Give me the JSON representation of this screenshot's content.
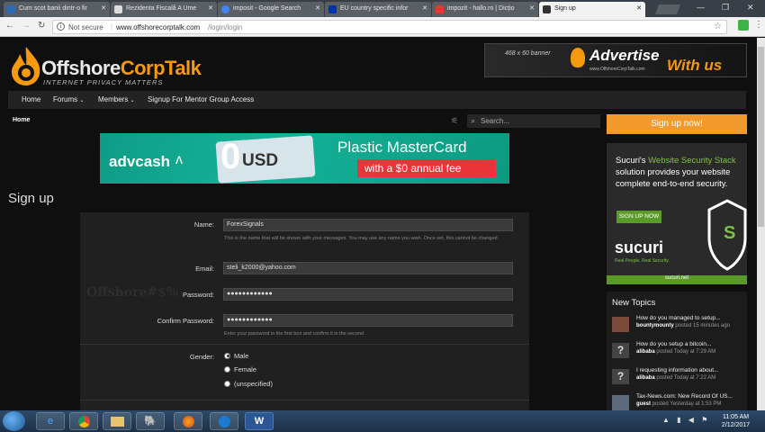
{
  "browser": {
    "tabs": [
      {
        "title": "Cum scot banii dintr-o fir",
        "favicon": "#2c6bb6"
      },
      {
        "title": "Rezidenta Fiscală A Ume",
        "favicon": "#ddd"
      },
      {
        "title": "imposit - Google Search",
        "favicon": "#4285f4"
      },
      {
        "title": "EU country specific infor",
        "favicon": "#0033aa"
      },
      {
        "title": "impozit - hallo.ro | Dicțio",
        "favicon": "#e33"
      },
      {
        "title": "Sign up",
        "favicon": "#333"
      }
    ],
    "security": "Not secure",
    "url_host": "www.offshorecorptalk.com",
    "url_path": "/login/login"
  },
  "site": {
    "logo_main": "Offshore",
    "logo_accent": "CorpTalk",
    "tagline": "INTERNET PRIVACY MATTERS",
    "ad_top": {
      "size": "468 x 60 banner",
      "line1": "Advertise",
      "line2": "With us",
      "url": "www.OffshoreCorpTalk.com"
    },
    "nav": [
      "Home",
      "Forums",
      "Members",
      "Signup For Mentor Group Access"
    ],
    "breadcrumb": "Home",
    "search_placeholder": "Search...",
    "banner": {
      "brand": "advcash",
      "amount": "0",
      "currency": "USD",
      "title": "Plastic MasterCard",
      "sub": "with a $0 annual fee"
    },
    "page_title": "Sign up",
    "watermark": "Offshore#$%"
  },
  "form": {
    "name_label": "Name:",
    "name_value": "ForexSignals",
    "name_hint": "This is the name that will be shown with your messages. You may use any name you wish. Once set, this cannot be changed.",
    "email_label": "Email:",
    "email_value": "steli_k2000@yahoo.com",
    "password_label": "Password:",
    "password_value": "●●●●●●●●●●●●",
    "confirm_label": "Confirm Password:",
    "confirm_value": "●●●●●●●●●●●●",
    "confirm_hint": "Enter your password in the first box and confirm it in the second.",
    "gender_label": "Gender:",
    "gender_options": [
      "Male",
      "Female",
      "(unspecified)"
    ],
    "gender_selected": "Male"
  },
  "sidebar": {
    "signup_button": "Sign up now!",
    "sucuri": {
      "line1": "Sucuri's",
      "line1_accent": "Website Security Stack",
      "body": "solution provides your website complete end-to-end security.",
      "cta": "SIGN UP NOW",
      "brand": "sucuri",
      "slogan": "Real People. Real Security.",
      "url": "sucuri.net"
    },
    "new_topics_title": "New Topics",
    "topics": [
      {
        "title": "How do you managed to setup...",
        "user": "bountymounty",
        "when": "posted 15 minutes ago"
      },
      {
        "title": "How do you setup a bitcoin...",
        "user": "alibaba",
        "when": "posted Today at 7:29 AM"
      },
      {
        "title": "I requesting information about...",
        "user": "alibaba",
        "when": "posted Today at 7:22 AM"
      },
      {
        "title": "Tax-News.com: New Record Of US...",
        "user": "guest",
        "when": "posted Yesterday at 1:53 PM"
      }
    ]
  },
  "taskbar": {
    "apps": [
      "IE",
      "Chrome",
      "Explorer",
      "Evernote",
      "Firefox",
      "TeamViewer",
      "Word"
    ],
    "time": "11:05 AM",
    "date": "2/12/2017"
  }
}
